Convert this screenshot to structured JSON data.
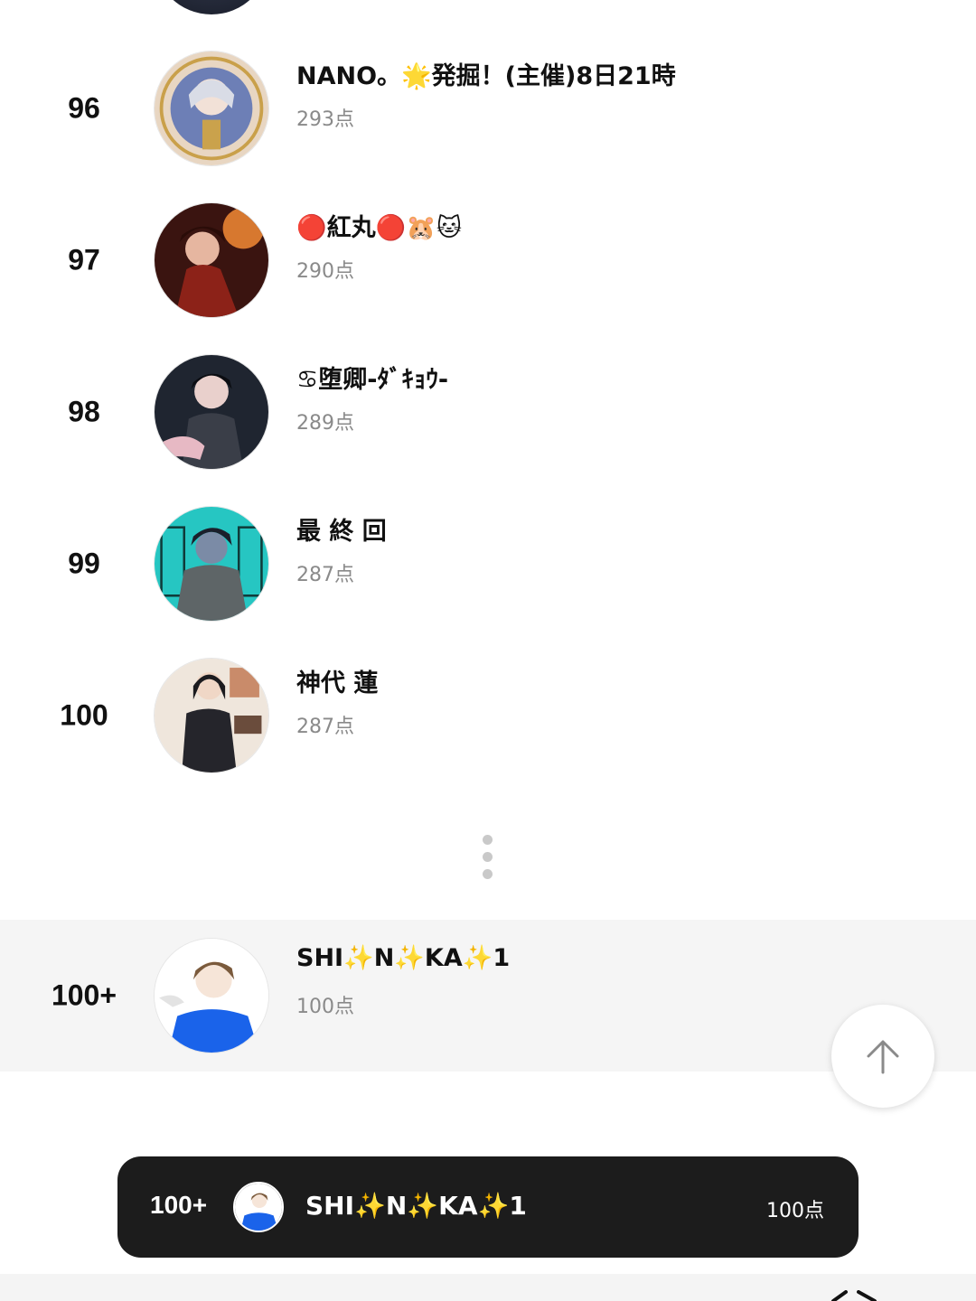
{
  "ranking": [
    {
      "rank": "96",
      "name": "NANO。🌟発掘！(主催)8日21時",
      "score": "293点"
    },
    {
      "rank": "97",
      "name": "🔴紅丸🔴🐹🐱",
      "score": "290点"
    },
    {
      "rank": "98",
      "name": "♋堕卿-ﾀﾞｷｮｳ-",
      "score": "289点"
    },
    {
      "rank": "99",
      "name": "最 終 回",
      "score": "287点"
    },
    {
      "rank": "100",
      "name": "神代  蓮",
      "score": "287点"
    }
  ],
  "me": {
    "rank": "100+",
    "name": "SHI✨N✨KA✨1",
    "score": "100点"
  },
  "bottom_bar": {
    "rank": "100+",
    "name": "SHI✨N✨KA✨1",
    "score": "100点"
  },
  "icons": {
    "scroll_top": "arrow-up-icon",
    "more": "vertical-dots-icon"
  }
}
